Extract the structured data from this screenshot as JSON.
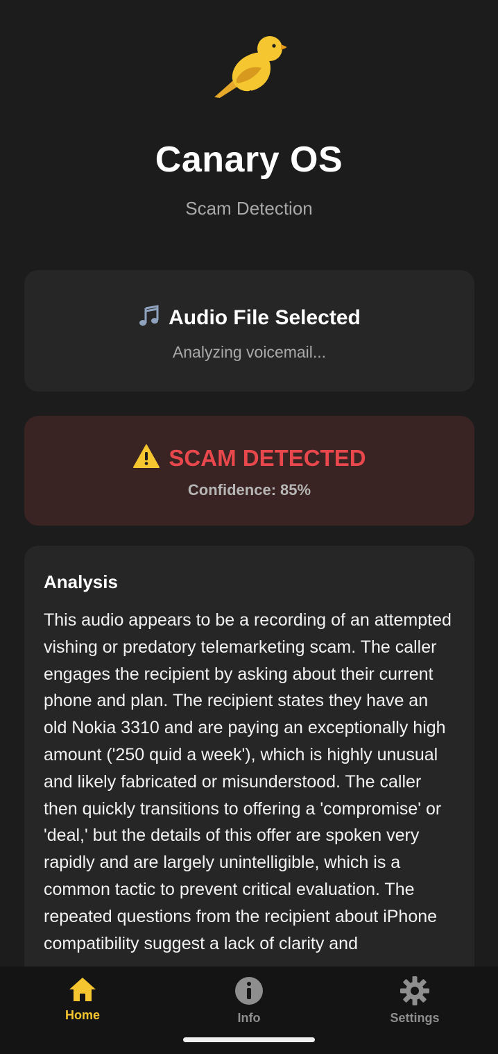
{
  "app": {
    "title": "Canary OS",
    "subtitle": "Scam Detection",
    "logo_icon": "canary-bird-icon"
  },
  "file_card": {
    "icon": "music-note-icon",
    "title": "Audio File Selected",
    "status": "Analyzing voicemail..."
  },
  "result_card": {
    "icon": "warning-icon",
    "title": "SCAM DETECTED",
    "confidence_label": "Confidence:",
    "confidence_value": "85%",
    "confidence_fraction": 0.85
  },
  "analysis": {
    "heading": "Analysis",
    "text": "This audio appears to be a recording of an attempted vishing or predatory telemarketing scam. The caller engages the recipient by asking about their current phone and plan. The recipient states they have an old Nokia 3310 and are paying an exceptionally high amount ('250 quid a week'), which is highly unusual and likely fabricated or misunderstood. The caller then quickly transitions to offering a 'compromise' or 'deal,' but the details of this offer are spoken very rapidly and are largely unintelligible, which is a common tactic to prevent critical evaluation. The repeated questions from the recipient about iPhone compatibility suggest a lack of clarity and"
  },
  "nav": {
    "items": [
      {
        "label": "Home",
        "icon": "home-icon",
        "active": true
      },
      {
        "label": "Info",
        "icon": "info-icon",
        "active": false
      },
      {
        "label": "Settings",
        "icon": "gear-icon",
        "active": false
      }
    ]
  },
  "colors": {
    "background": "#1c1c1c",
    "card": "#262626",
    "scam_card": "#3a2323",
    "scam_red": "#e8484c",
    "accent_yellow": "#f6c630",
    "muted_text": "#a9a9a9"
  }
}
